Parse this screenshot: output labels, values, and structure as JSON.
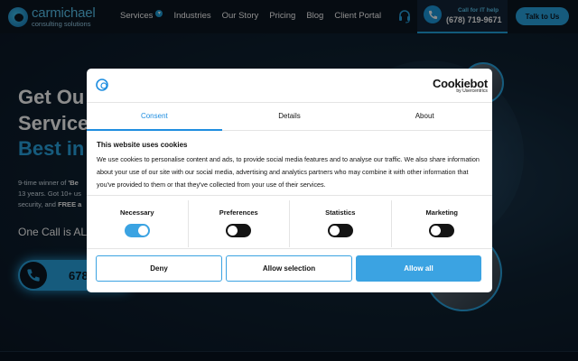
{
  "header": {
    "logo_name": "carmichael",
    "logo_sub": "consulting solutions",
    "nav": [
      "Services",
      "Industries",
      "Our Story",
      "Pricing",
      "Blog",
      "Client Portal"
    ],
    "call_label": "Call for IT help",
    "call_number": "(678) 719-9671",
    "talk_label": "Talk to Us"
  },
  "hero": {
    "line1": "Get Ou",
    "line2": "Service",
    "line3": "Best in",
    "para_a": "9-time winner of ",
    "para_b": "'Be",
    "para_c": "13 years. Got 10+ us",
    "para_d": "security, and ",
    "para_e": "FREE a",
    "one_call": "One Call is AL",
    "phone": "678"
  },
  "cookie": {
    "brand": "Cookiebot",
    "brand_by": "by Usercentrics",
    "tabs": [
      "Consent",
      "Details",
      "About"
    ],
    "heading": "This website uses cookies",
    "body": "We use cookies to personalise content and ads, to provide social media features and to analyse our traffic. We also share information about your use of our site with our social media, advertising and analytics partners who may combine it with other information that you've provided to them or that they've collected from your use of their services.",
    "toggles": [
      {
        "label": "Necessary",
        "on": true
      },
      {
        "label": "Preferences",
        "on": false
      },
      {
        "label": "Statistics",
        "on": false
      },
      {
        "label": "Marketing",
        "on": false
      }
    ],
    "deny": "Deny",
    "allow_selection": "Allow selection",
    "allow_all": "Allow all"
  },
  "colors": {
    "accent": "#29a6e3",
    "dialog_accent": "#3ba3e2",
    "dark_bg": "#0b1622"
  }
}
